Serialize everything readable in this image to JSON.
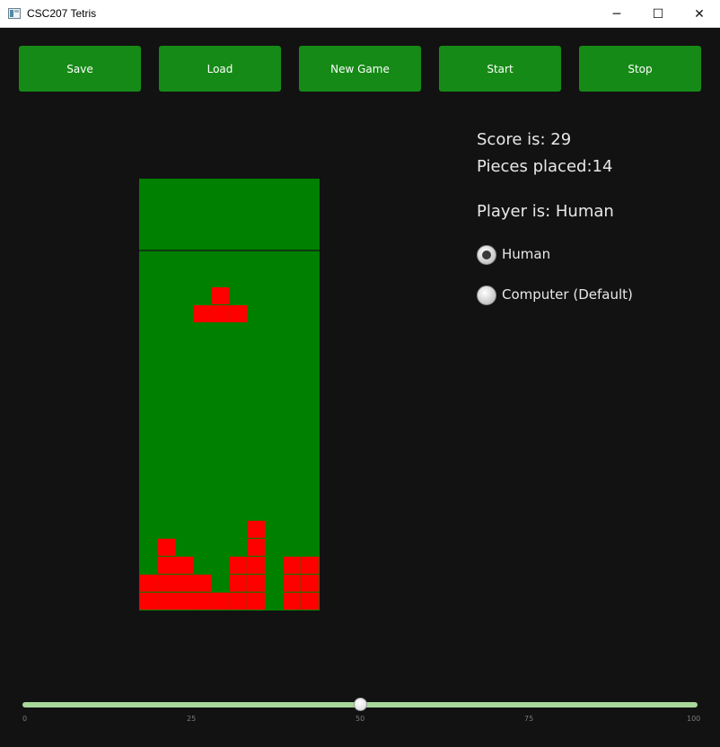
{
  "window": {
    "title": "CSC207 Tetris",
    "minimize_glyph": "─",
    "maximize_glyph": "☐",
    "close_glyph": "✕"
  },
  "toolbar": {
    "buttons": [
      {
        "id": "save",
        "label": "Save"
      },
      {
        "id": "load",
        "label": "Load"
      },
      {
        "id": "new-game",
        "label": "New Game"
      },
      {
        "id": "start",
        "label": "Start"
      },
      {
        "id": "stop",
        "label": "Stop"
      }
    ]
  },
  "board": {
    "columns": 10,
    "rows": 24,
    "background_color": "#008000",
    "block_color": "#ff0000",
    "falling_piece": [
      [
        4,
        6
      ],
      [
        3,
        7
      ],
      [
        4,
        7
      ],
      [
        5,
        7
      ]
    ],
    "placed_blocks": [
      [
        6,
        19
      ],
      [
        1,
        20
      ],
      [
        6,
        20
      ],
      [
        1,
        21
      ],
      [
        2,
        21
      ],
      [
        5,
        21
      ],
      [
        6,
        21
      ],
      [
        8,
        21
      ],
      [
        9,
        21
      ],
      [
        0,
        22
      ],
      [
        1,
        22
      ],
      [
        2,
        22
      ],
      [
        3,
        22
      ],
      [
        5,
        22
      ],
      [
        6,
        22
      ],
      [
        8,
        22
      ],
      [
        9,
        22
      ],
      [
        0,
        23
      ],
      [
        1,
        23
      ],
      [
        2,
        23
      ],
      [
        3,
        23
      ],
      [
        4,
        23
      ],
      [
        5,
        23
      ],
      [
        6,
        23
      ],
      [
        8,
        23
      ],
      [
        9,
        23
      ]
    ]
  },
  "status": {
    "score_text": "Score is: 29",
    "pieces_text": "Pieces placed:14",
    "player_text": "Player is: Human"
  },
  "player_options": [
    {
      "label": "Human",
      "selected": true
    },
    {
      "label": "Computer (Default)",
      "selected": false
    }
  ],
  "speed_slider": {
    "min": 0,
    "max": 100,
    "value": 50,
    "ticks": [
      "0",
      "25",
      "50",
      "75",
      "100"
    ]
  },
  "colors": {
    "button_bg": "#168a16",
    "window_bg": "#121212",
    "slider_track": "#a8d89a"
  }
}
